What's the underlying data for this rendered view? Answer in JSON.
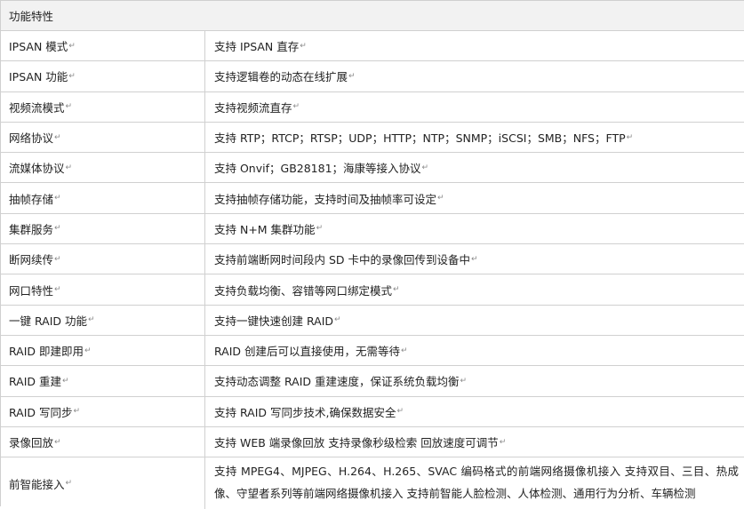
{
  "header": {
    "title": "功能特性"
  },
  "paragraph_mark": "↵",
  "rows": [
    {
      "name": "IPSAN 模式",
      "desc": "支持 IPSAN 直存"
    },
    {
      "name": "IPSAN 功能",
      "desc": "支持逻辑卷的动态在线扩展"
    },
    {
      "name": "视频流模式",
      "desc": "支持视频流直存"
    },
    {
      "name": "网络协议",
      "desc": "支持 RTP；RTCP；RTSP；UDP；HTTP；NTP；SNMP；iSCSI；SMB；NFS；FTP"
    },
    {
      "name": "流媒体协议",
      "desc": "支持 Onvif；GB28181；海康等接入协议"
    },
    {
      "name": "抽帧存储",
      "desc": "支持抽帧存储功能，支持时间及抽帧率可设定"
    },
    {
      "name": "集群服务",
      "desc": "支持 N+M 集群功能"
    },
    {
      "name": "断网续传",
      "desc": "支持前端断网时间段内 SD 卡中的录像回传到设备中"
    },
    {
      "name": "网口特性",
      "desc": "支持负载均衡、容错等网口绑定模式"
    },
    {
      "name": "一键 RAID 功能",
      "desc": "支持一键快速创建 RAID"
    },
    {
      "name": "RAID 即建即用",
      "desc": "RAID 创建后可以直接使用，无需等待"
    },
    {
      "name": "RAID 重建",
      "desc": "支持动态调整 RAID 重建速度，保证系统负载均衡"
    },
    {
      "name": "RAID 写同步",
      "desc": "支持 RAID 写同步技术,确保数据安全"
    },
    {
      "name": "录像回放",
      "desc": "支持 WEB 端录像回放 支持录像秒级检索 回放速度可调节"
    },
    {
      "name": "前智能接入",
      "desc": "支持 MPEG4、MJPEG、H.264、H.265、SVAC 编码格式的前端网络摄像机接入 支持双目、三目、热成像、守望者系列等前端网络摄像机接入 支持前智能人脸检测、人体检测、通用行为分析、车辆检测"
    }
  ]
}
